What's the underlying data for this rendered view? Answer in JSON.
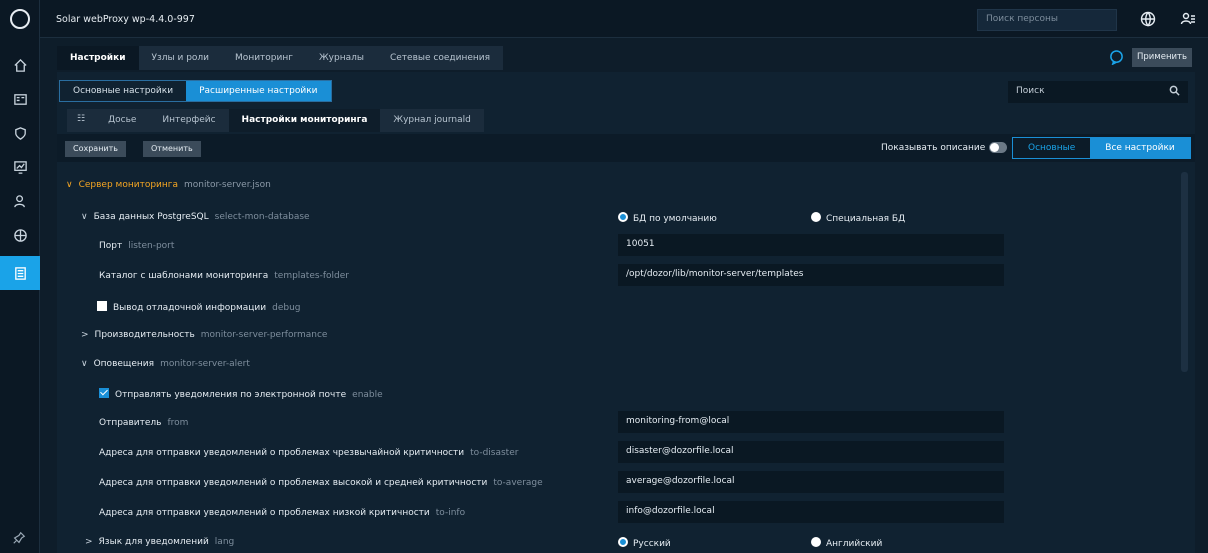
{
  "app": {
    "title": "Solar webProxy   wp-4.4.0-997",
    "person_search_placeholder": "Поиск персоны"
  },
  "main_tabs": [
    "Настройки",
    "Узлы и роли",
    "Мониторинг",
    "Журналы",
    "Сетевые соединения"
  ],
  "apply_label": "Применить",
  "sub_tabs": [
    "Основные настройки",
    "Расширенные настройки"
  ],
  "panel_search_placeholder": "Поиск",
  "section_tabs": [
    "Досье",
    "Интерфейс",
    "Настройки мониторинга",
    "Журнал journald"
  ],
  "actions": {
    "save": "Сохранить",
    "cancel": "Отменить",
    "show_description": "Показывать описание",
    "basic": "Основные",
    "all": "Все настройки"
  },
  "tree": {
    "monitor_server": {
      "label": "Сервер мониторинга",
      "key": "monitor-server.json"
    },
    "database": {
      "label": "База данных PostgreSQL",
      "key": "select-mon-database",
      "opt_default": "БД по умолчанию",
      "opt_special": "Специальная БД"
    },
    "port": {
      "label": "Порт",
      "key": "listen-port",
      "value": "10051"
    },
    "templates": {
      "label": "Каталог с шаблонами мониторинга",
      "key": "templates-folder",
      "value": "/opt/dozor/lib/monitor-server/templates"
    },
    "debug": {
      "label": "Вывод отладочной информации",
      "key": "debug"
    },
    "performance": {
      "label": "Производительность",
      "key": "monitor-server-performance"
    },
    "alerts": {
      "label": "Оповещения",
      "key": "monitor-server-alert"
    },
    "email": {
      "label": "Отправлять уведомления по электронной почте",
      "key": "enable"
    },
    "from": {
      "label": "Отправитель",
      "key": "from",
      "value": "monitoring-from@local"
    },
    "to_disaster": {
      "label": "Адреса для отправки уведомлений о проблемах чрезвычайной критичности",
      "key": "to-disaster",
      "value": "disaster@dozorfile.local"
    },
    "to_average": {
      "label": "Адреса для отправки уведомлений о проблемах высокой и средней критичности",
      "key": "to-average",
      "value": "average@dozorfile.local"
    },
    "to_info": {
      "label": "Адреса для отправки уведомлений о проблемах низкой критичности",
      "key": "to-info",
      "value": "info@dozorfile.local"
    },
    "lang": {
      "label": "Язык для уведомлений",
      "key": "lang",
      "opt_ru": "Русский",
      "opt_en": "Английский"
    }
  }
}
